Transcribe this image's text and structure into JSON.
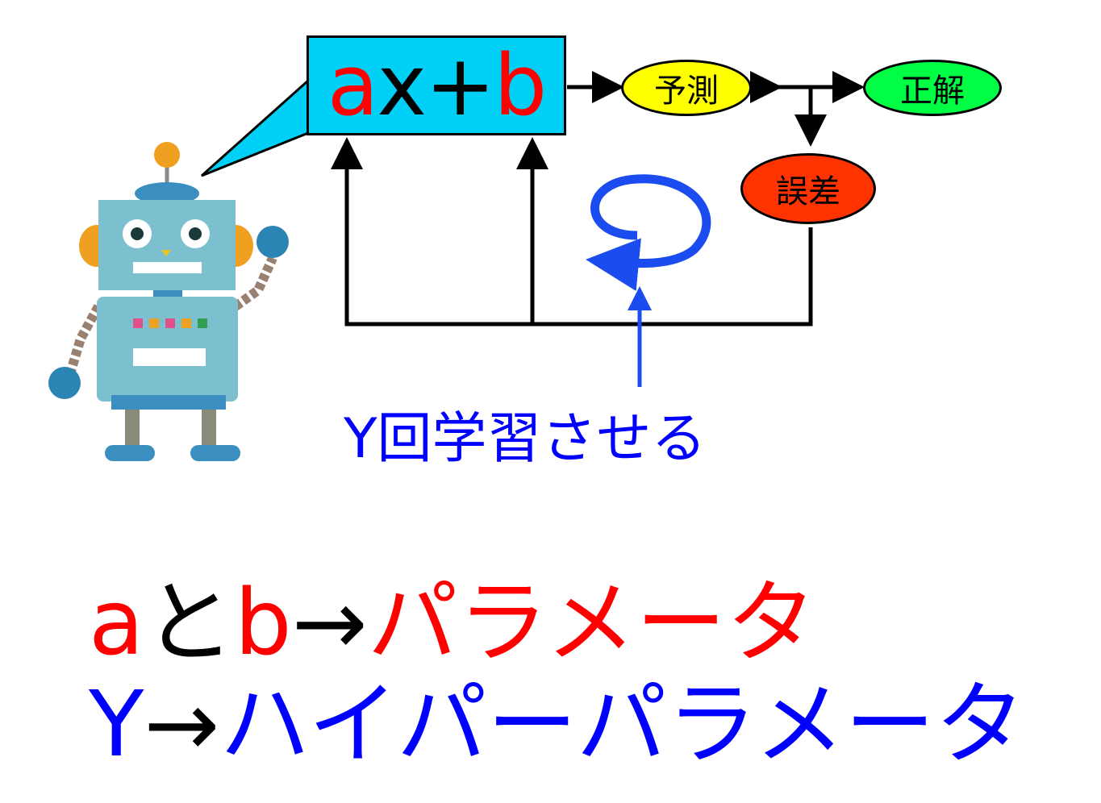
{
  "formula": {
    "a": "a",
    "x": "x",
    "plus": "+",
    "b": "b"
  },
  "nodes": {
    "prediction": "予測",
    "correct": "正解",
    "error": "誤差"
  },
  "loop_label": "Y回学習させる",
  "summary": {
    "line1": {
      "a": "a",
      "and": "と",
      "b": "b",
      "arrow": "→",
      "term": "パラメータ"
    },
    "line2": {
      "y": "Y",
      "arrow": "→",
      "term": "ハイパーパラメータ"
    }
  },
  "colors": {
    "formula_box": "#00d0f5",
    "prediction": "#ffff00",
    "correct": "#00ff44",
    "error": "#ff3300",
    "parameter_text": "#ff0000",
    "hyperparameter_text": "#0000ff",
    "arrows": "#000000",
    "loop_arrow": "#1a4cf0"
  },
  "icons": [
    "robot-illustration",
    "speech-bubble-tail",
    "loop-arrow-icon"
  ]
}
